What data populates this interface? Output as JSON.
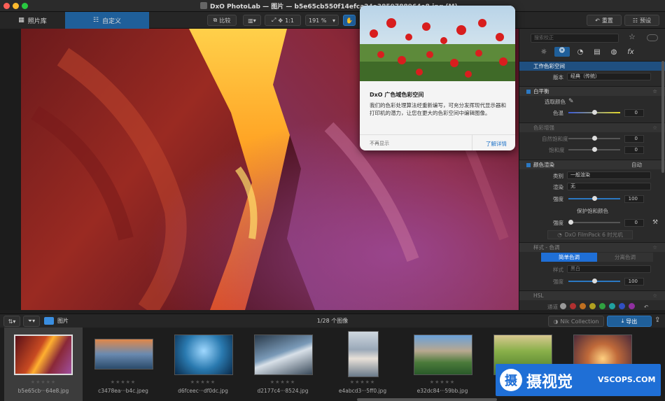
{
  "window": {
    "title": "DxO PhotoLab — 图片 — b5e65cb550f14efca24a3859788964e8.jpg (M)"
  },
  "toolbar": {
    "library_tab": "照片库",
    "customize_tab": "自定义",
    "compare_label": "比较",
    "ratio_label": "1:1",
    "zoom_value": "191 %",
    "reset_label": "重置",
    "preset_label": "预设"
  },
  "popup": {
    "title": "DxO 广色域色彩空间",
    "body": "我们的色彩处理算法经重新编写，可充分发挥现代显示器和打印机的潜力，让您在更大的色彩空间中编辑图像。",
    "dismiss_label": "不再显示",
    "learn_more_label": "了解详情"
  },
  "panel": {
    "search_placeholder": "搜索校正",
    "working_color_space": {
      "title": "工作色彩空间",
      "version_label": "版本",
      "version_value": "经典（传统）"
    },
    "white_balance": {
      "title": "白平衡",
      "picker_label": "选取颜色",
      "temp_label": "色温",
      "temp_value": "0"
    },
    "color_enhance": {
      "title": "色彩增强",
      "vibrance_label": "自然饱和度",
      "vibrance_value": "0",
      "saturation_label": "饱和度",
      "saturation_value": "0"
    },
    "color_render": {
      "title": "颜色渲染",
      "auto_label": "自动",
      "category_label": "类别",
      "category_value": "一般渲染",
      "render_label": "渲染",
      "render_value": "无",
      "intensity_label": "强度",
      "intensity_value": "100",
      "protect_label": "保护饱和颜色",
      "protect_intensity_label": "强度",
      "protect_intensity_value": "0",
      "filmpack_label": "DxO FilmPack 6 时光机"
    },
    "style_tone": {
      "title": "样式 - 色调",
      "simple_tab": "简单色调",
      "split_tab": "分离色调",
      "style_label": "样式",
      "style_value": "黑白",
      "intensity_label": "强度",
      "intensity_value": "100"
    },
    "hsl": {
      "title": "HSL",
      "channel_label": "通道"
    }
  },
  "filmbar": {
    "folder_label": "图片",
    "count_label": "1/28 个图像",
    "nik_label": "Nik Collection",
    "export_label": "导出"
  },
  "thumbnails": [
    {
      "name": "b5e65cb···64e8.jpg",
      "stars": "★★★★★"
    },
    {
      "name": "c3478ea···b4c.jpeg",
      "stars": "★★★★★"
    },
    {
      "name": "d6fceec···df0dc.jpg",
      "stars": "★★★★★"
    },
    {
      "name": "d2177c4···8524.jpg",
      "stars": "★★★★★"
    },
    {
      "name": "e4abcd3···5ff0.jpg",
      "stars": "★★★★★"
    },
    {
      "name": "e32dc84···59bb.jpg",
      "stars": "★★★★★"
    },
    {
      "name": "",
      "stars": ""
    },
    {
      "name": "",
      "stars": ""
    }
  ],
  "watermark": {
    "glyph": "摄",
    "text": "摄视觉",
    "domain": "VSCOPS.COM"
  }
}
